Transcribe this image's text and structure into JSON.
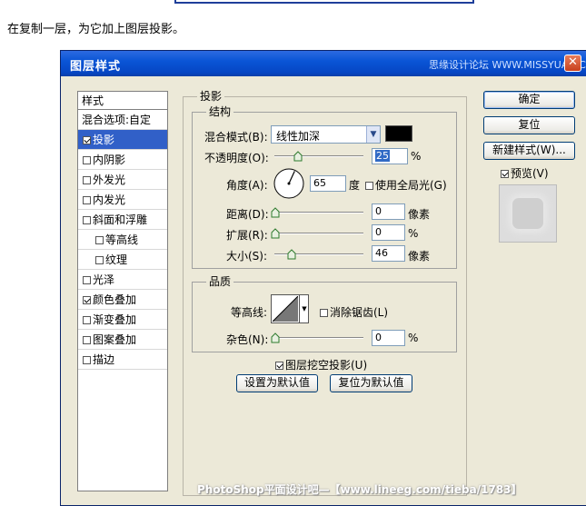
{
  "caption": "在复制一层，为它加上图层投影。",
  "dialog": {
    "title": "图层样式",
    "watermark": "思缘设计论坛 WWW.MISSYUAN.COM",
    "close_label": "✕"
  },
  "left_panel": {
    "header": "样式",
    "blend_options": "混合选项:自定",
    "items": [
      {
        "label": "投影",
        "checked": true,
        "selected": true,
        "sub": false
      },
      {
        "label": "内阴影",
        "checked": false,
        "selected": false,
        "sub": false
      },
      {
        "label": "外发光",
        "checked": false,
        "selected": false,
        "sub": false
      },
      {
        "label": "内发光",
        "checked": false,
        "selected": false,
        "sub": false
      },
      {
        "label": "斜面和浮雕",
        "checked": false,
        "selected": false,
        "sub": false
      },
      {
        "label": "等高线",
        "checked": false,
        "selected": false,
        "sub": true
      },
      {
        "label": "纹理",
        "checked": false,
        "selected": false,
        "sub": true
      },
      {
        "label": "光泽",
        "checked": false,
        "selected": false,
        "sub": false
      },
      {
        "label": "颜色叠加",
        "checked": true,
        "selected": false,
        "sub": false
      },
      {
        "label": "渐变叠加",
        "checked": false,
        "selected": false,
        "sub": false
      },
      {
        "label": "图案叠加",
        "checked": false,
        "selected": false,
        "sub": false
      },
      {
        "label": "描边",
        "checked": false,
        "selected": false,
        "sub": false
      }
    ]
  },
  "shadow": {
    "section_title": "投影",
    "structure_title": "结构",
    "blend_mode_label": "混合模式(B):",
    "blend_mode_value": "线性加深",
    "blend_color": "#000000",
    "opacity_label": "不透明度(O):",
    "opacity_value": "25",
    "opacity_unit": "%",
    "opacity_level": 0.25,
    "angle_label": "角度(A):",
    "angle_value": "65",
    "angle_unit": "度",
    "use_global_label": "使用全局光(G)",
    "use_global_checked": false,
    "distance_label": "距离(D):",
    "distance_value": "0",
    "distance_unit": "像素",
    "distance_level": 0,
    "spread_label": "扩展(R):",
    "spread_value": "0",
    "spread_unit": "%",
    "spread_level": 0,
    "size_label": "大小(S):",
    "size_value": "46",
    "size_unit": "像素",
    "size_level": 0.18,
    "quality_title": "品质",
    "contour_label": "等高线:",
    "antialias_label": "消除锯齿(L)",
    "antialias_checked": false,
    "noise_label": "杂色(N):",
    "noise_value": "0",
    "noise_unit": "%",
    "noise_level": 0,
    "knockout_label": "图层挖空投影(U)",
    "knockout_checked": true,
    "set_default_label": "设置为默认值",
    "reset_default_label": "复位为默认值"
  },
  "buttons": {
    "ok": "确定",
    "reset": "复位",
    "new_style": "新建样式(W)...",
    "preview_label": "预览(V)",
    "preview_checked": true
  },
  "footer_watermark": "PhotoShop平面设计吧—【www.lineeg.com/tieba/1783】",
  "colors": {
    "title_bar": "#0a55d6",
    "selection": "#3160c8",
    "dialog_bg": "#ece9d8"
  }
}
